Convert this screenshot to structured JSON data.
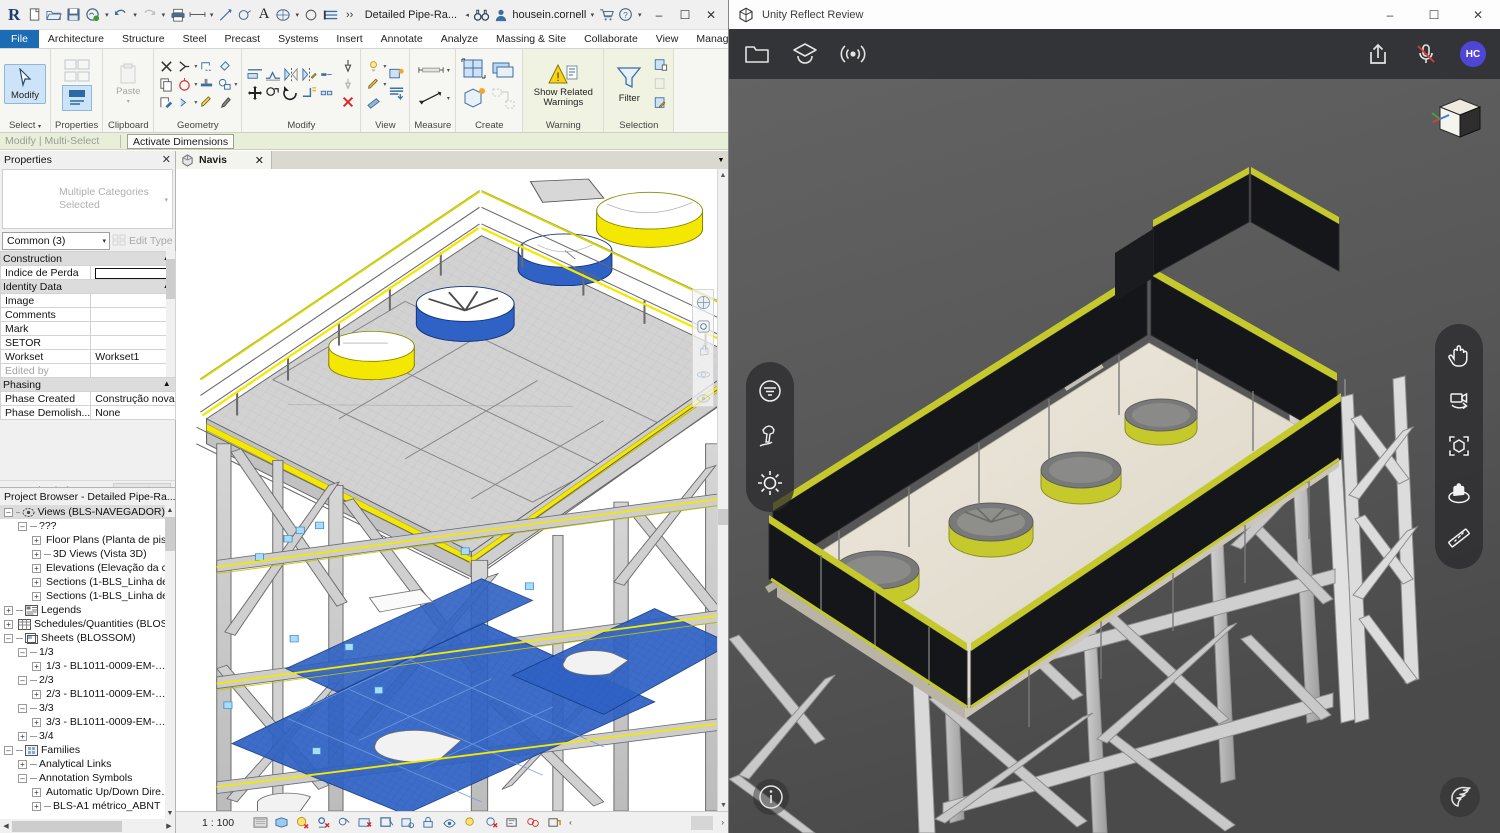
{
  "revit": {
    "app_logo": "R",
    "quick_access": [
      {
        "name": "new-project-icon",
        "label": "New"
      },
      {
        "name": "open-project-icon",
        "label": "Open"
      },
      {
        "name": "save-icon",
        "label": "Save"
      },
      {
        "name": "save-as-cloud-icon",
        "label": "Save As"
      },
      {
        "name": "undo-icon",
        "label": "Undo"
      },
      {
        "name": "redo-icon",
        "label": "Redo"
      },
      {
        "name": "print-icon",
        "label": "Print"
      },
      {
        "name": "measure-icon",
        "label": "Measure"
      },
      {
        "name": "aligned-dimension-icon",
        "label": "Aligned Dimension"
      },
      {
        "name": "tag-icon",
        "label": "Tag by Category"
      },
      {
        "name": "text-icon",
        "label": "Text"
      },
      {
        "name": "default-3d-view-icon",
        "label": "Default 3D View"
      },
      {
        "name": "section-icon",
        "label": "Section"
      },
      {
        "name": "thin-lines-icon",
        "label": "Thin Lines"
      },
      {
        "name": "close-hidden-windows-icon",
        "label": "Close Hidden Windows"
      }
    ],
    "document_name": "Detailed Pipe-Ra...",
    "search_icon": "search-binoculars-icon",
    "user_name": "housein.cornell",
    "cart_icon": "autodesk-store-icon",
    "help_icon": "help-icon",
    "window_buttons": {
      "minimize": "–",
      "maximize": "☐",
      "close": "✕"
    },
    "ribbon_tabs": [
      "File",
      "Architecture",
      "Structure",
      "Steel",
      "Precast",
      "Systems",
      "Insert",
      "Annotate",
      "Analyze",
      "Massing & Site",
      "Collaborate",
      "View",
      "Manage"
    ],
    "ribbon_panels": [
      {
        "label": "Select",
        "buttons": [
          {
            "label": "Modify",
            "icon": "cursor-arrow-icon"
          }
        ]
      },
      {
        "label": "Properties",
        "buttons": [
          {
            "label": "Properties",
            "icon": "properties-panel-icon"
          }
        ]
      },
      {
        "label": "Clipboard",
        "buttons": [
          {
            "label": "Paste",
            "icon": "paste-icon"
          }
        ]
      },
      {
        "label": "Geometry",
        "buttons": []
      },
      {
        "label": "Modify",
        "buttons": []
      },
      {
        "label": "View",
        "buttons": []
      },
      {
        "label": "Measure",
        "buttons": []
      },
      {
        "label": "Create",
        "buttons": []
      },
      {
        "label": "Warning",
        "buttons": [
          {
            "label": "Show Related Warnings",
            "icon": "warning-triangle-icon"
          }
        ]
      },
      {
        "label": "Selection",
        "buttons": [
          {
            "label": "Filter",
            "icon": "filter-funnel-icon"
          }
        ]
      }
    ],
    "context_bar": {
      "label": "Modify | Multi-Select",
      "activate_dimensions": "Activate Dimensions"
    },
    "properties": {
      "title": "Properties",
      "close_icon": "close-icon",
      "type_selector": "Multiple Categories Selected",
      "family_dropdown": "Common (3)",
      "edit_type": "Edit Type",
      "groups": [
        {
          "name": "Construction",
          "rows": [
            {
              "key": "Indice de Perda",
              "value": "",
              "editing": true
            }
          ]
        },
        {
          "name": "Identity Data",
          "rows": [
            {
              "key": "Image",
              "value": ""
            },
            {
              "key": "Comments",
              "value": ""
            },
            {
              "key": "Mark",
              "value": ""
            },
            {
              "key": "SETOR",
              "value": ""
            },
            {
              "key": "Workset",
              "value": "Workset1"
            },
            {
              "key": "Edited by",
              "value": "",
              "dim": true
            }
          ]
        },
        {
          "name": "Phasing",
          "rows": [
            {
              "key": "Phase Created",
              "value": "Construção nova"
            },
            {
              "key": "Phase Demolish...",
              "value": "None"
            }
          ]
        }
      ],
      "help_link": "Properties help",
      "apply_button": "Apply"
    },
    "project_browser": {
      "title": "Project Browser - Detailed Pipe-Ra...",
      "close_icon": "close-icon",
      "nodes": [
        {
          "label": "Views (BLS-NAVEGADOR)",
          "depth": 0,
          "expander": "–",
          "icon": "views-icon",
          "selected": true
        },
        {
          "label": "???",
          "depth": 1,
          "expander": "–",
          "icon": ""
        },
        {
          "label": "Floor Plans (Planta de pis…",
          "depth": 2,
          "expander": "+",
          "icon": ""
        },
        {
          "label": "3D Views (Vista 3D)",
          "depth": 2,
          "expander": "+",
          "icon": ""
        },
        {
          "label": "Elevations (Elevação da c…",
          "depth": 2,
          "expander": "+",
          "icon": ""
        },
        {
          "label": "Sections (1-BLS_Linha de…",
          "depth": 2,
          "expander": "+",
          "icon": ""
        },
        {
          "label": "Sections (1-BLS_Linha de…",
          "depth": 2,
          "expander": "+",
          "icon": ""
        },
        {
          "label": "Legends",
          "depth": 0,
          "expander": "+",
          "icon": "legend-icon"
        },
        {
          "label": "Schedules/Quantities (BLOSS…",
          "depth": 0,
          "expander": "+",
          "icon": "schedule-icon"
        },
        {
          "label": "Sheets (BLOSSOM)",
          "depth": 0,
          "expander": "–",
          "icon": "sheets-icon"
        },
        {
          "label": "1/3",
          "depth": 1,
          "expander": "–",
          "icon": ""
        },
        {
          "label": "1/3 - BL1011-0009-EM-…",
          "depth": 2,
          "expander": "+",
          "icon": ""
        },
        {
          "label": "2/3",
          "depth": 1,
          "expander": "–",
          "icon": ""
        },
        {
          "label": "2/3 - BL1011-0009-EM-…",
          "depth": 2,
          "expander": "+",
          "icon": ""
        },
        {
          "label": "3/3",
          "depth": 1,
          "expander": "–",
          "icon": ""
        },
        {
          "label": "3/3 - BL1011-0009-EM-…",
          "depth": 2,
          "expander": "+",
          "icon": ""
        },
        {
          "label": "3/4",
          "depth": 1,
          "expander": "+",
          "icon": ""
        },
        {
          "label": "Families",
          "depth": 0,
          "expander": "–",
          "icon": "families-icon"
        },
        {
          "label": "Analytical Links",
          "depth": 1,
          "expander": "+",
          "icon": ""
        },
        {
          "label": "Annotation Symbols",
          "depth": 1,
          "expander": "–",
          "icon": ""
        },
        {
          "label": "Automatic Up/Down Dire…",
          "depth": 2,
          "expander": "+",
          "icon": ""
        },
        {
          "label": "BLS-A1 métrico_ABNT",
          "depth": 2,
          "expander": "+",
          "icon": ""
        }
      ]
    },
    "view_tab": {
      "label": "Navis",
      "icon": "view-cube-icon",
      "close_icon": "close-icon"
    },
    "status_bar": {
      "scale": "1 : 100",
      "icons": [
        "scale-icon",
        "detail-level-icon",
        "visual-style-icon",
        "sun-path-icon",
        "shadows-icon",
        "render-dialog-icon",
        "crop-view-icon",
        "show-crop-icon",
        "lock-3d-view-icon",
        "temporary-hide-icon",
        "reveal-hidden-icon",
        "temporary-view-properties-icon",
        "hide-analytical-icon",
        "highlight-displacement-icon",
        "reveal-constraints-icon"
      ],
      "more_caret": "‹",
      "right_caret": "›"
    }
  },
  "unity": {
    "window_title": "Unity Reflect Review",
    "logo_icon": "unity-logo-icon",
    "window_buttons": {
      "minimize": "–",
      "maximize": "☐",
      "close": "✕"
    },
    "toolbar_left": [
      {
        "name": "projects-folder-icon",
        "label": "Projects"
      },
      {
        "name": "layers-icon",
        "label": "Layers"
      },
      {
        "name": "broadcast-icon",
        "label": "Collaborate"
      }
    ],
    "toolbar_right": [
      {
        "name": "share-icon",
        "label": "Share"
      },
      {
        "name": "microphone-muted-icon",
        "label": "Microphone muted"
      }
    ],
    "avatar_initials": "HC",
    "left_rail": [
      {
        "name": "filter-layers-icon",
        "label": "Filters"
      },
      {
        "name": "scene-environment-icon",
        "label": "Scene settings"
      },
      {
        "name": "sun-study-icon",
        "label": "Sun study"
      }
    ],
    "right_rail": [
      {
        "name": "pan-hand-icon",
        "label": "Pan"
      },
      {
        "name": "camera-orbit-icon",
        "label": "Orbit camera"
      },
      {
        "name": "select-object-icon",
        "label": "Select object"
      },
      {
        "name": "walk-mode-icon",
        "label": "Walk"
      },
      {
        "name": "measure-tool-icon",
        "label": "Measure"
      }
    ],
    "gizmo_icon": "view-cube-gizmo",
    "info_icon": "info-icon",
    "wing_icon": "wing-icon"
  },
  "colors": {
    "revit_ribbon_bg": "#f6f6f2",
    "revit_file_tab": "#1b6bb5",
    "revit_context_bar": "#e8efd8",
    "selection_blue": "#2f62c4",
    "handle_blue": "#9fd4f5",
    "model_yellow": "#f5e800",
    "unity_toolbar": "#333437",
    "unity_viewport": "#5b5b5b",
    "unity_accent": "#4f46d6",
    "unity_model_yellow": "#c6c92c"
  }
}
